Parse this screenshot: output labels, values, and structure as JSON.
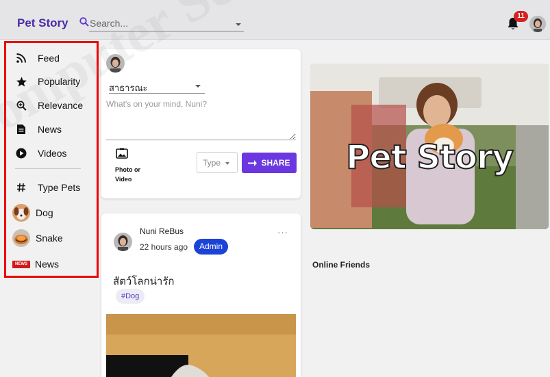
{
  "app": {
    "brand": "Pet Story"
  },
  "search": {
    "placeholder": "Search..."
  },
  "notifications": {
    "count": "11"
  },
  "sidebar": {
    "items": [
      {
        "label": "Feed",
        "icon": "rss-icon"
      },
      {
        "label": "Popularity",
        "icon": "star-icon"
      },
      {
        "label": "Relevance",
        "icon": "zoom-in-icon"
      },
      {
        "label": "News",
        "icon": "article-icon"
      },
      {
        "label": "Videos",
        "icon": "play-circle-icon"
      }
    ],
    "section_title": "Type Pets",
    "section_icon": "hash-icon",
    "pets": [
      {
        "label": "Dog",
        "icon": "dog-avatar"
      },
      {
        "label": "Snake",
        "icon": "snake-avatar"
      },
      {
        "label": "News",
        "icon": "news-badge-icon",
        "badge": "NEWS"
      }
    ]
  },
  "composer": {
    "privacy": "สาธารณะ",
    "placeholder": "What's on your mind, Nuni?",
    "photo_label": "Photo or Video",
    "type_placeholder": "Type",
    "share_label": "SHARE"
  },
  "post": {
    "author": "Nuni ReBus",
    "time": "22 hours ago",
    "role_badge": "Admin",
    "more": "···",
    "text": "สัตว์โลกน่ารัก",
    "tag": "#Dog"
  },
  "banner": {
    "title": "Pet Story"
  },
  "online": {
    "heading": "Online Friends"
  },
  "watermark": "Computer Science, Faculty of Informatics, Mahasarakham",
  "colors": {
    "brand": "#4a2aa8",
    "share": "#6a37e0",
    "admin": "#1b43d8",
    "highlight": "#ee0000",
    "badge": "#d32222"
  }
}
